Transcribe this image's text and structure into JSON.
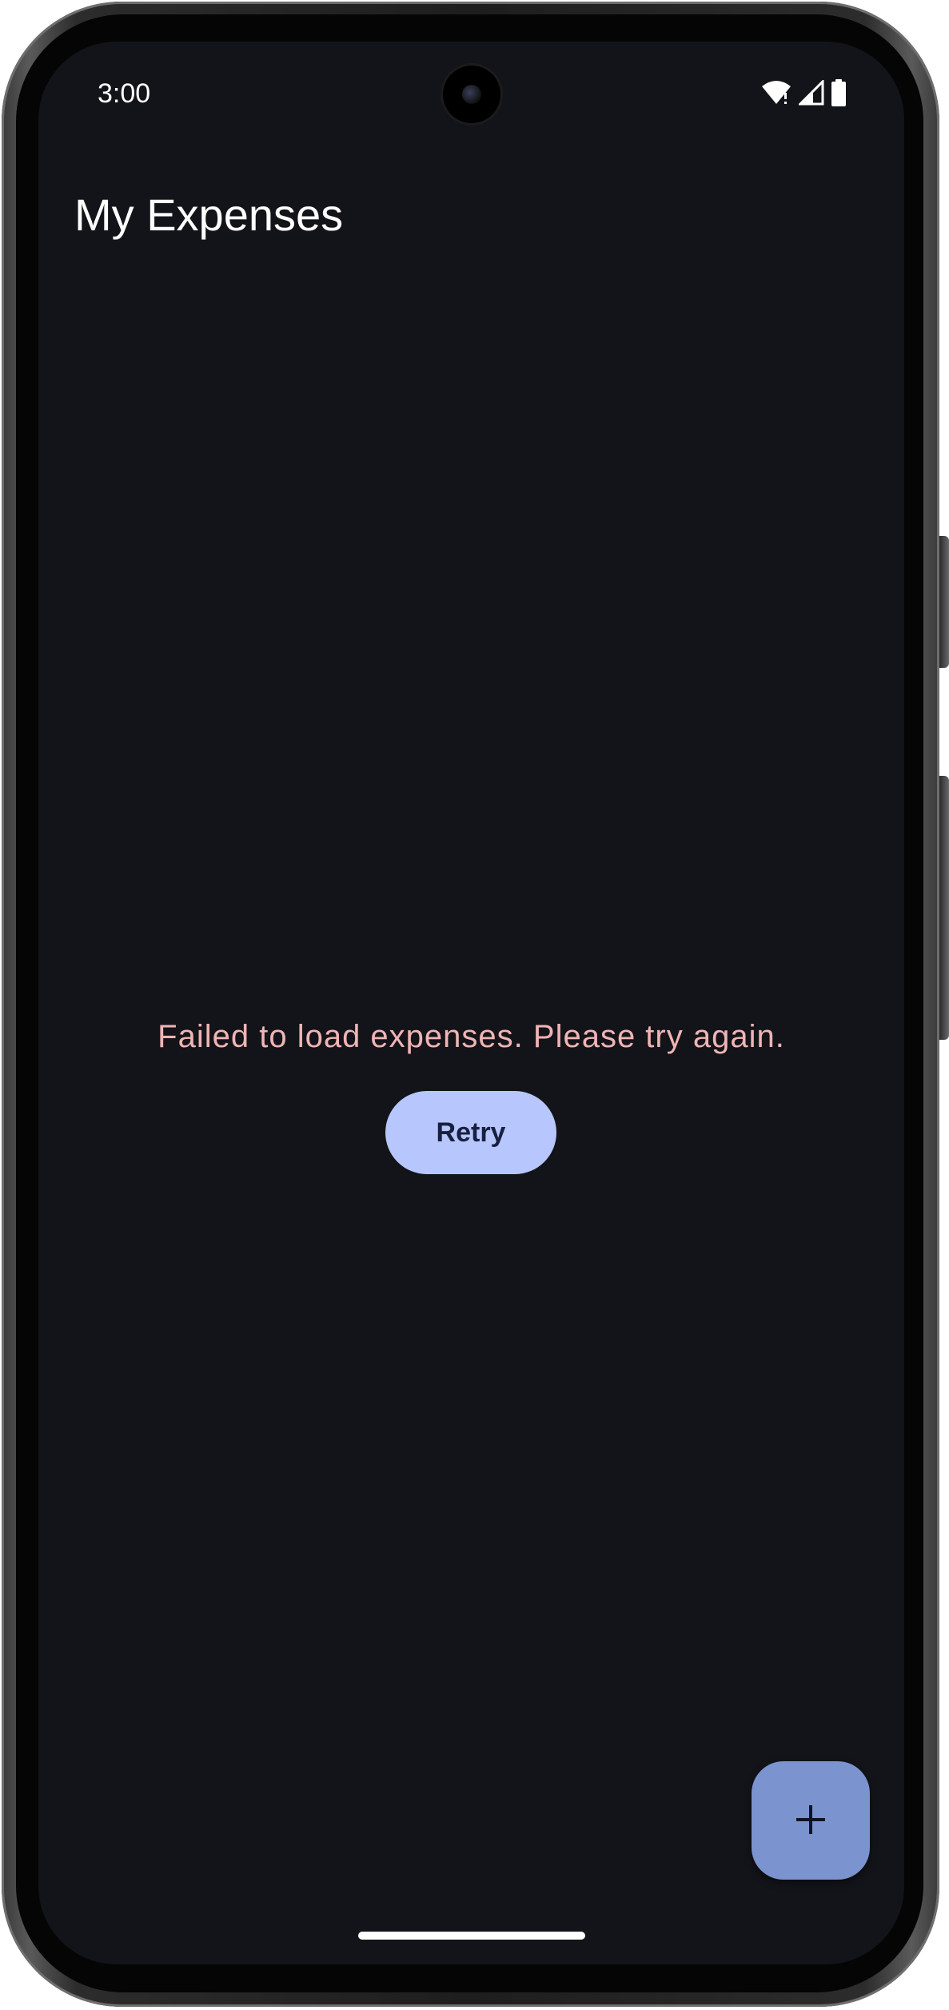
{
  "status_bar": {
    "time": "3:00",
    "icons": [
      "wifi-alert-icon",
      "signal-icon",
      "battery-icon"
    ]
  },
  "app_bar": {
    "title": "My Expenses"
  },
  "error_state": {
    "message": "Failed to load expenses. Please try again.",
    "retry_label": "Retry"
  },
  "fab": {
    "icon": "plus-icon",
    "symbol": "+"
  },
  "colors": {
    "background": "#131419",
    "error_text": "#f0b4b4",
    "retry_button": "#b7c6fd",
    "fab": "#7b93cf"
  }
}
